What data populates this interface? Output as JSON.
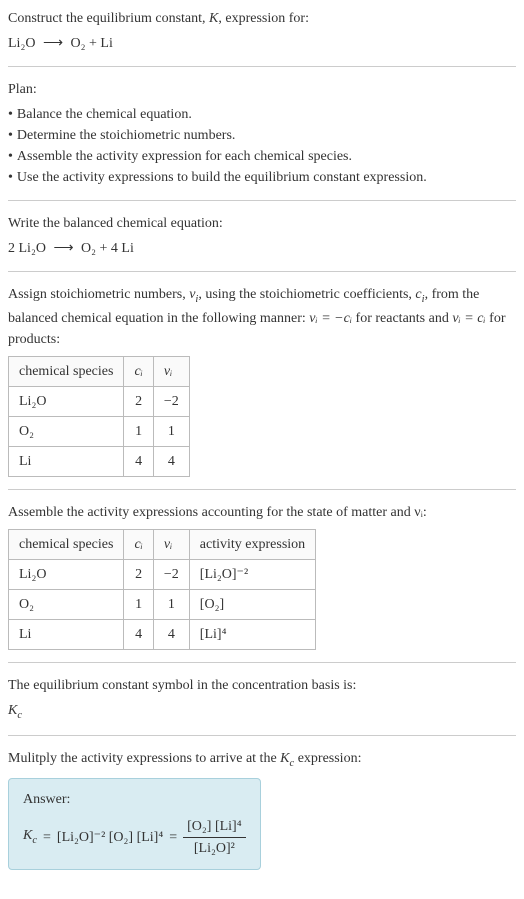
{
  "intro": {
    "line1": "Construct the equilibrium constant, ",
    "K": "K",
    "line1b": ", expression for:",
    "reactant": "Li₂O",
    "arrow": "⟶",
    "product1": "O₂",
    "plus": " + ",
    "product2": "Li"
  },
  "plan": {
    "title": "Plan:",
    "items": [
      "Balance the chemical equation.",
      "Determine the stoichiometric numbers.",
      "Assemble the activity expression for each chemical species.",
      "Use the activity expressions to build the equilibrium constant expression."
    ]
  },
  "balanced": {
    "title": "Write the balanced chemical equation:",
    "coef1": "2 ",
    "reactant": "Li₂O",
    "arrow": "⟶",
    "product1": "O₂",
    "plus": " + ",
    "coef2": "4 ",
    "product2": "Li"
  },
  "stoich": {
    "text1": "Assign stoichiometric numbers, ",
    "nu": "ν",
    "sub_i": "i",
    "text2": ", using the stoichiometric coefficients, ",
    "c": "c",
    "text3": ", from the balanced chemical equation in the following manner: ",
    "eq1": "νᵢ = −cᵢ",
    "text4": " for reactants and ",
    "eq2": "νᵢ = cᵢ",
    "text5": " for products:",
    "headers": [
      "chemical species",
      "cᵢ",
      "νᵢ"
    ],
    "rows": [
      {
        "species": "Li₂O",
        "c": "2",
        "nu": "−2"
      },
      {
        "species": "O₂",
        "c": "1",
        "nu": "1"
      },
      {
        "species": "Li",
        "c": "4",
        "nu": "4"
      }
    ]
  },
  "activity": {
    "title": "Assemble the activity expressions accounting for the state of matter and νᵢ:",
    "headers": [
      "chemical species",
      "cᵢ",
      "νᵢ",
      "activity expression"
    ],
    "rows": [
      {
        "species": "Li₂O",
        "c": "2",
        "nu": "−2",
        "expr": "[Li₂O]⁻²"
      },
      {
        "species": "O₂",
        "c": "1",
        "nu": "1",
        "expr": "[O₂]"
      },
      {
        "species": "Li",
        "c": "4",
        "nu": "4",
        "expr": "[Li]⁴"
      }
    ]
  },
  "symbol": {
    "title": "The equilibrium constant symbol in the concentration basis is:",
    "value": "K",
    "sub": "c"
  },
  "multiply": {
    "title": "Mulitply the activity expressions to arrive at the ",
    "Kc": "K",
    "sub": "c",
    "title2": " expression:"
  },
  "answer": {
    "label": "Answer:",
    "lhs_K": "K",
    "lhs_sub": "c",
    "eq": " = ",
    "term1": "[Li₂O]⁻² [O₂] [Li]⁴",
    "eq2": " = ",
    "num": "[O₂] [Li]⁴",
    "den": "[Li₂O]²"
  }
}
